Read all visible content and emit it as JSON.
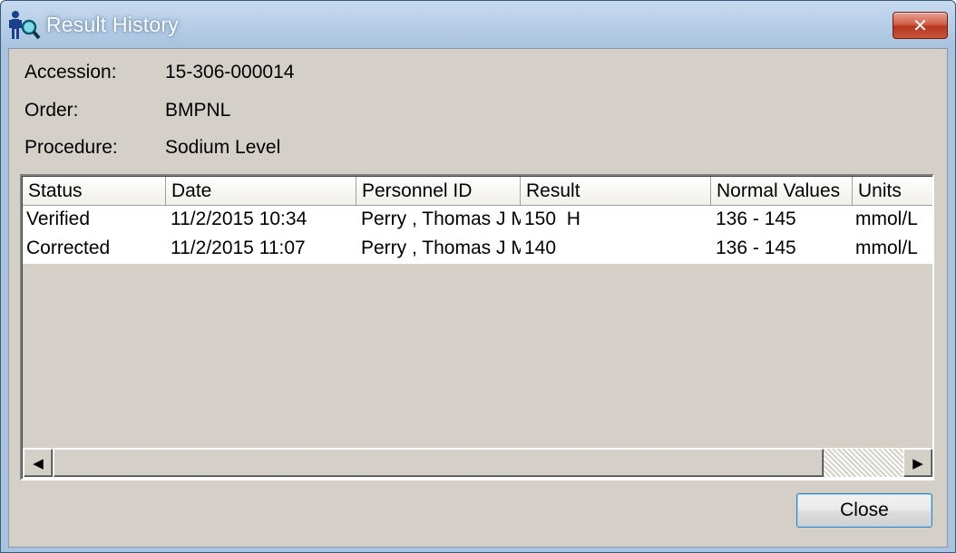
{
  "window": {
    "title": "Result History",
    "close_glyph": "✕"
  },
  "fields": {
    "accession_label": "Accession:",
    "accession_value": "15-306-000014",
    "order_label": "Order:",
    "order_value": "BMPNL",
    "procedure_label": "Procedure:",
    "procedure_value": "Sodium Level"
  },
  "table": {
    "columns": [
      "Status",
      "Date",
      "Personnel ID",
      "Result",
      "Normal Values",
      "Units"
    ],
    "rows": [
      [
        "Verified",
        "11/2/2015 10:34",
        "Perry , Thomas J M",
        "150  H",
        "136 - 145",
        "mmol/L"
      ],
      [
        "Corrected",
        "11/2/2015 11:07",
        "Perry , Thomas J M",
        "140",
        "136 - 145",
        "mmol/L"
      ]
    ]
  },
  "scrollbar": {
    "left_arrow": "◀",
    "right_arrow": "▶"
  },
  "buttons": {
    "close_label": "Close"
  }
}
